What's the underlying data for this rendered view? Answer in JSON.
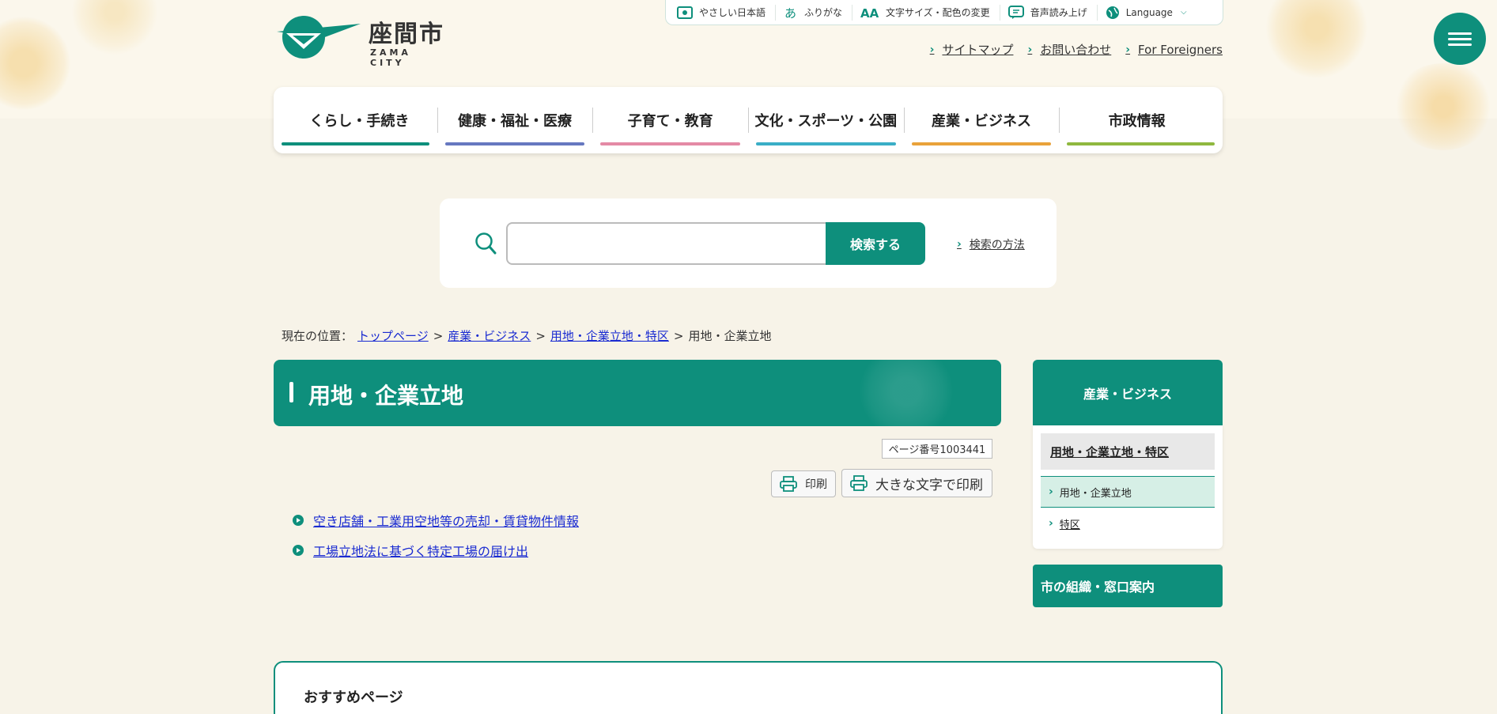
{
  "logo": {
    "name": "座間市",
    "sub": "ZAMA CITY"
  },
  "utility": {
    "items": [
      {
        "label": "やさしい日本語",
        "icon": "easy-japanese-icon"
      },
      {
        "label": "ふりがな",
        "icon": "furigana-icon"
      },
      {
        "label": "文字サイズ・配色の変更",
        "icon": "text-size-icon"
      },
      {
        "label": "音声読み上げ",
        "icon": "speech-icon"
      },
      {
        "label": "Language",
        "icon": "globe-icon"
      }
    ]
  },
  "toplinks": [
    "サイトマップ",
    "お問い合わせ",
    "For Foreigners"
  ],
  "nav": {
    "items": [
      {
        "label": "くらし・手続き",
        "color": "#0e8f7c"
      },
      {
        "label": "健康・福祉・医療",
        "color": "#6678c0"
      },
      {
        "label": "子育て・教育",
        "color": "#e48aa5"
      },
      {
        "label": "文化・スポーツ・公園",
        "color": "#3aaec6"
      },
      {
        "label": "産業・ビジネス",
        "color": "#e9a23a"
      },
      {
        "label": "市政情報",
        "color": "#8fb83f"
      }
    ]
  },
  "search": {
    "button": "検索する",
    "help": "検索の方法",
    "value": ""
  },
  "breadcrumb": {
    "prefix": "現在の位置：",
    "links": [
      "トップページ",
      "産業・ビジネス",
      "用地・企業立地・特区"
    ],
    "current": "用地・企業立地",
    "sep": ">"
  },
  "page": {
    "title": "用地・企業立地",
    "page_no": "ページ番号1003441",
    "print": "印刷",
    "print_large": "大きな文字で印刷",
    "links": [
      "空き店舗・工業用空地等の売却・賃貸物件情報",
      "工場立地法に基づく特定工場の届け出"
    ]
  },
  "sidebar": {
    "head": "産業・ビジネス",
    "section": "用地・企業立地・特区",
    "items": [
      "用地・企業立地",
      "特区"
    ],
    "org": "市の組織・窓口案内"
  },
  "recommend": {
    "title": "おすすめページ"
  },
  "colors": {
    "primary": "#0e8f7c",
    "link": "#1a2bd1"
  }
}
